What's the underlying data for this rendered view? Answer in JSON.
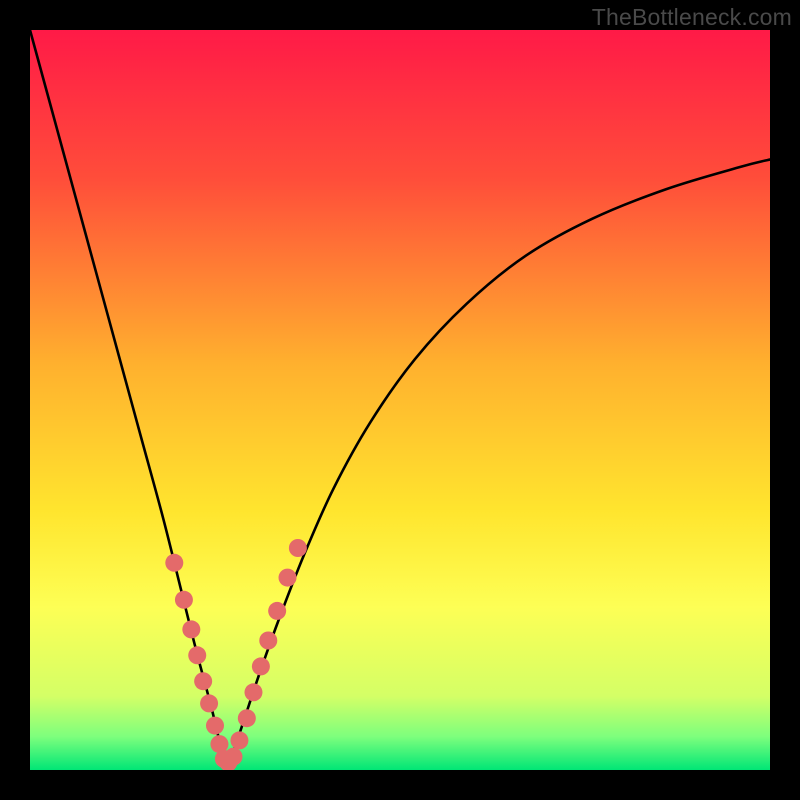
{
  "watermark": "TheBottleneck.com",
  "chart_data": {
    "type": "line",
    "title": "",
    "xlabel": "",
    "ylabel": "",
    "xlim": [
      0,
      1
    ],
    "ylim": [
      0,
      100
    ],
    "optimum_x": 0.265,
    "gradient_stops": [
      {
        "offset": 0.0,
        "color": "#ff1a47"
      },
      {
        "offset": 0.2,
        "color": "#ff4d3a"
      },
      {
        "offset": 0.45,
        "color": "#ffb02e"
      },
      {
        "offset": 0.65,
        "color": "#ffe52e"
      },
      {
        "offset": 0.78,
        "color": "#fdff55"
      },
      {
        "offset": 0.9,
        "color": "#d4ff66"
      },
      {
        "offset": 0.955,
        "color": "#7dff7d"
      },
      {
        "offset": 1.0,
        "color": "#00e676"
      }
    ],
    "series": [
      {
        "name": "bottleneck-curve",
        "x": [
          0.0,
          0.03,
          0.06,
          0.09,
          0.12,
          0.15,
          0.18,
          0.205,
          0.225,
          0.245,
          0.258,
          0.265,
          0.275,
          0.29,
          0.31,
          0.335,
          0.37,
          0.41,
          0.46,
          0.52,
          0.59,
          0.67,
          0.76,
          0.86,
          0.96,
          1.0
        ],
        "values": [
          100.0,
          89.0,
          78.0,
          67.0,
          56.0,
          45.0,
          34.0,
          24.0,
          16.0,
          8.5,
          3.0,
          0.0,
          2.5,
          7.0,
          13.0,
          20.0,
          29.0,
          38.0,
          47.0,
          55.5,
          63.0,
          69.5,
          74.5,
          78.5,
          81.5,
          82.5
        ]
      }
    ],
    "dots": {
      "name": "sample-points",
      "color": "#e46a6a",
      "radius": 9,
      "x": [
        0.195,
        0.208,
        0.218,
        0.226,
        0.234,
        0.242,
        0.25,
        0.256,
        0.262,
        0.268,
        0.275,
        0.283,
        0.293,
        0.302,
        0.312,
        0.322,
        0.334,
        0.348,
        0.362
      ],
      "values": [
        28.0,
        23.0,
        19.0,
        15.5,
        12.0,
        9.0,
        6.0,
        3.5,
        1.5,
        1.0,
        1.8,
        4.0,
        7.0,
        10.5,
        14.0,
        17.5,
        21.5,
        26.0,
        30.0
      ]
    }
  }
}
